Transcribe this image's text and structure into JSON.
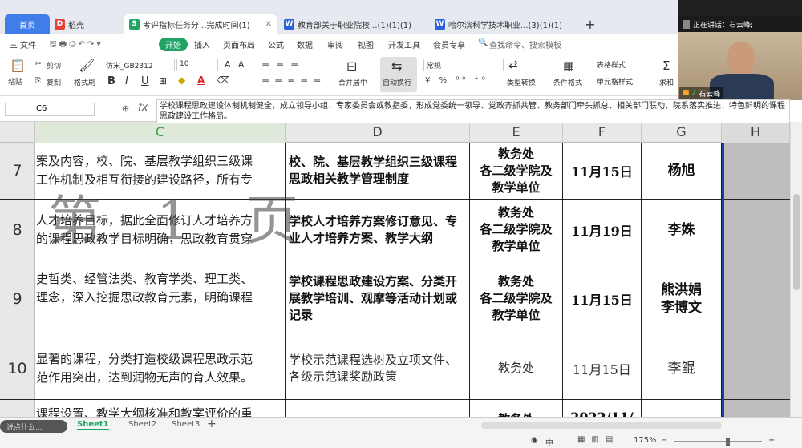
{
  "tabs": [
    {
      "label": "首页"
    },
    {
      "label": "稻壳",
      "icon": "D"
    },
    {
      "label": "考评指标任务分...完成时间(1)",
      "icon": "S"
    },
    {
      "label": "教育部关于职业院校...(1)(1)(1)",
      "icon": "W"
    },
    {
      "label": "哈尔滨科学技术职业...(3)(1)(1)",
      "icon": "W"
    }
  ],
  "add_tab": "+",
  "menu": {
    "file": "三 文件",
    "start": "开始",
    "items": [
      "插入",
      "页面布局",
      "公式",
      "数据",
      "审阅",
      "视图",
      "开发工具",
      "会员专享"
    ],
    "search": "查找命令、搜索模板"
  },
  "toolbar": {
    "paste": "粘贴",
    "cut": "剪切",
    "copy": "复制",
    "format_painter": "格式刷",
    "font": "仿宋_GB2312",
    "size": "10",
    "bold": "B",
    "italic": "I",
    "underline": "U",
    "merge": "合并居中",
    "wrap": "自动换行",
    "numfmt": "常规",
    "type_convert": "类型转换",
    "cond_fmt": "条件格式",
    "table_style": "表格样式",
    "cell_style": "单元格样式",
    "sum": "求和",
    "filter": "筛选"
  },
  "formula": {
    "cell_ref": "C6",
    "fx": "fx",
    "content": "学校课程思政建设体制机制健全，成立领导小组、专家委员会或教指委，形成党委统一领导、党政齐抓共管、教务部门牵头抓总、相关部门联动、院系落实推进、特色鲜明的课程思政建设工作格局。"
  },
  "columns": [
    "C",
    "D",
    "E",
    "F",
    "G",
    "H"
  ],
  "rows": [
    {
      "num": "7",
      "c": "案及内容，校、院、基层教学组织三级课\n工作机制及相互衔接的建设路径，所有专",
      "d": "校、院、基层教学组织三级课程思政相关教学管理制度",
      "e": "教务处\n各二级学院及\n教学单位",
      "f": "11月15日",
      "g": "杨旭"
    },
    {
      "num": "8",
      "c": "人才培养目标，据此全面修订人才培养方\n的课程思政教学目标明确，思政教育贯穿",
      "d": "学校人才培养方案修订意见、专业人才培养方案、教学大纲",
      "e": "教务处\n各二级学院及\n教学单位",
      "f": "11月19日",
      "g": "李姝"
    },
    {
      "num": "9",
      "c": "史哲类、经管法类、教育学类、理工类、\n理念，深入挖掘思政教育元素，明确课程",
      "d": "学校课程思政建设方案、分类开展教学培训、观摩等活动计划或记录",
      "e": "教务处\n各二级学院及\n教学单位",
      "f": "11月15日",
      "g": "熊洪娟\n李博文"
    },
    {
      "num": "10",
      "c": "显著的课程，分类打造校级课程思政示范\n范作用突出，达到润物无声的育人效果。",
      "d": "学校示范课程选树及立项文件、各级示范课奖励政策",
      "e": "教务处",
      "f": "11月15日",
      "g": "李鲲"
    },
    {
      "num": "",
      "c": "课程设置、教学大纲核准和教案评价的重",
      "d": "",
      "e": "教务处",
      "f": "2022/11/",
      "g": ""
    }
  ],
  "watermark": "第 1 页",
  "sheets": [
    "Sheet1",
    "Sheet2",
    "Sheet3"
  ],
  "add_sheet": "+",
  "status": {
    "hint": "说点什么...",
    "zoom": "175%",
    "lang": "中"
  },
  "video": {
    "speaking": "正在讲话：石云峰;",
    "name": "石云峰"
  }
}
